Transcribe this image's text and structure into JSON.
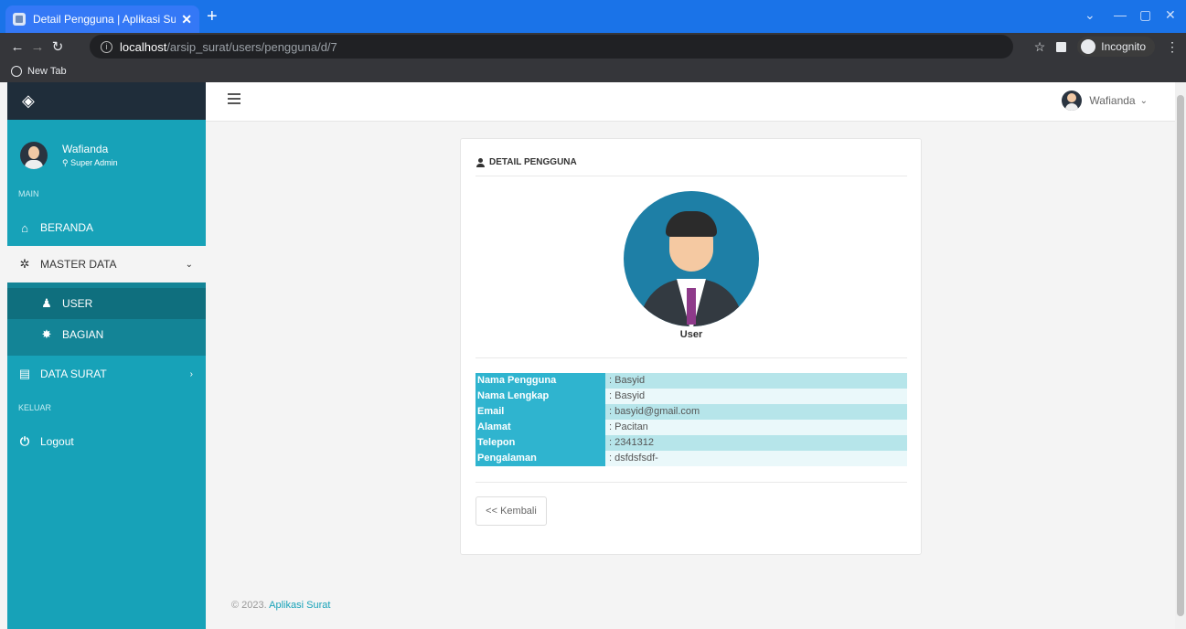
{
  "browser": {
    "tab_title": "Detail Pengguna | Aplikasi Surat",
    "url_host": "localhost",
    "url_path": "/arsip_surat/users/pengguna/d/7",
    "incognito_label": "Incognito",
    "bookmark_label": "New Tab"
  },
  "sidebar": {
    "user_name": "Wafianda",
    "user_role": "Super Admin",
    "section_main": "MAIN",
    "beranda": "BERANDA",
    "master_data": "MASTER DATA",
    "user": "USER",
    "bagian": "BAGIAN",
    "data_surat": "DATA SURAT",
    "section_keluar": "KELUAR",
    "logout": "Logout"
  },
  "topbar": {
    "user_name": "Wafianda"
  },
  "card": {
    "title": "DETAIL PENGGUNA",
    "photo_caption": "User",
    "fields": [
      {
        "label": "Nama Pengguna",
        "value": ": Basyid"
      },
      {
        "label": "Nama Lengkap",
        "value": ": Basyid"
      },
      {
        "label": "Email",
        "value": ": basyid@gmail.com"
      },
      {
        "label": "Alamat",
        "value": ": Pacitan"
      },
      {
        "label": "Telepon",
        "value": ": 2341312"
      },
      {
        "label": "Pengalaman",
        "value": ": dsfdsfsdf-"
      }
    ],
    "back_label": "<< Kembali"
  },
  "footer": {
    "copyright": "© 2023.",
    "app_link": "Aplikasi Surat"
  },
  "colors": {
    "sidebar": "#17a2b8",
    "label_cell": "#2fb4cf",
    "browser_tabbar": "#1a73e8"
  }
}
